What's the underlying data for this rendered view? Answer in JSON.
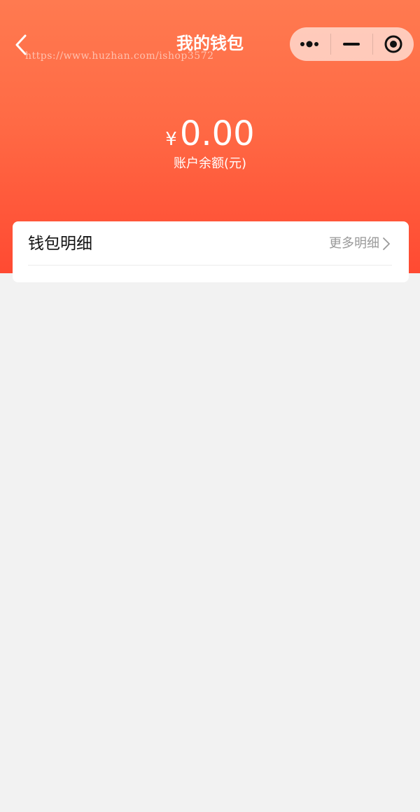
{
  "nav": {
    "title": "我的钱包",
    "watermark": "https://www.huzhan.com/ishop3572"
  },
  "balance": {
    "currency": "¥",
    "amount": "0.00",
    "label": "账户余额(元)"
  },
  "wallet_card": {
    "title": "钱包明细",
    "more_label": "更多明细"
  },
  "colors": {
    "header_top": "#ff7a50",
    "header_bottom": "#ff4a32",
    "background": "#f2f2f2"
  },
  "icons": {
    "back": "chevron-left-icon",
    "menu": "more-dots-icon",
    "minimize": "minimize-icon",
    "close": "target-circle-icon",
    "more_arrow": "chevron-right-icon"
  }
}
